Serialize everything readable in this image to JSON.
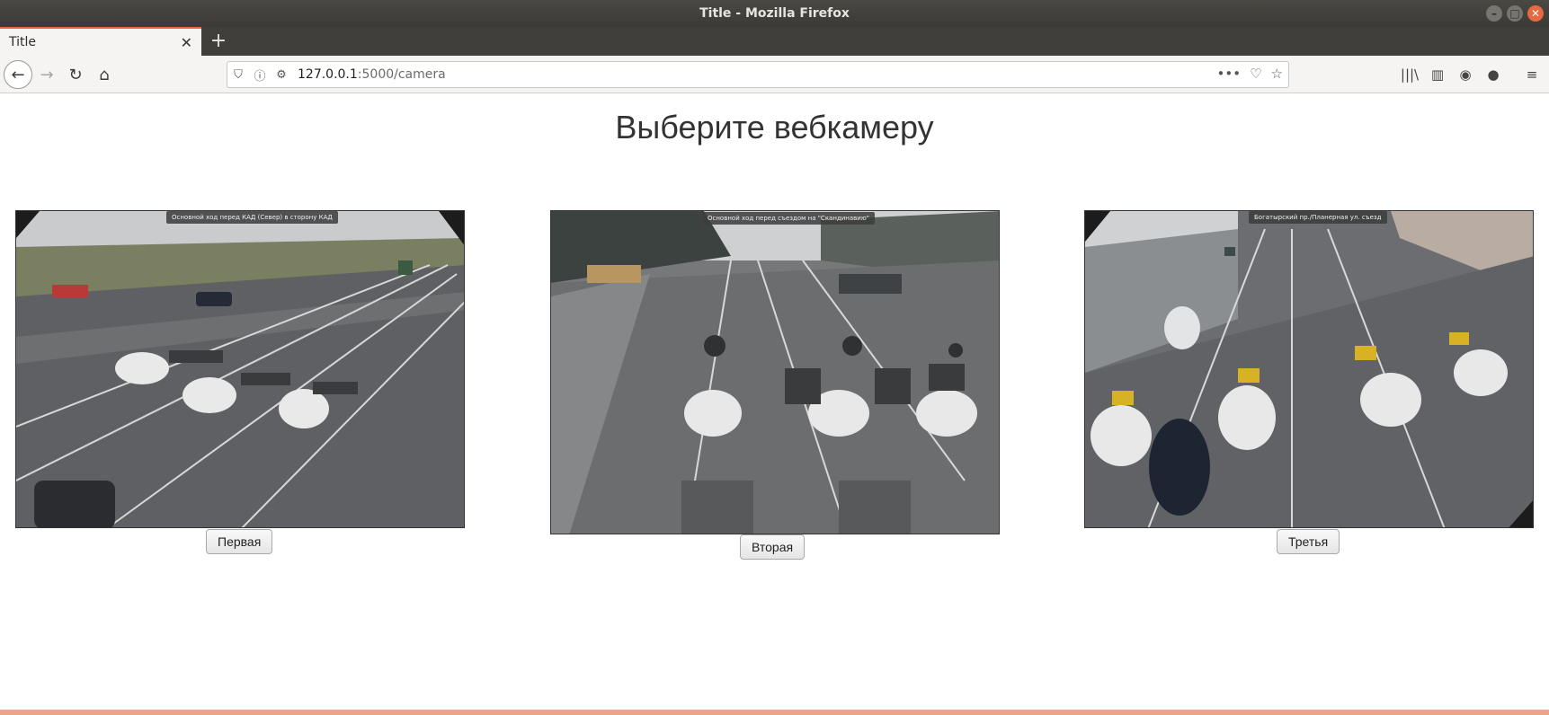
{
  "window": {
    "title": "Title - Mozilla Firefox",
    "controls": {
      "minimize": "–",
      "maximize": "□",
      "close": "✕"
    }
  },
  "tabs": [
    {
      "label": "Title",
      "close": "✕"
    }
  ],
  "new_tab_label": "+",
  "nav": {
    "back": "←",
    "forward": "→",
    "reload": "↻",
    "home": "⌂"
  },
  "urlbar": {
    "host": "127.0.0.1",
    "path": ":5000/camera",
    "shield": "⛉",
    "info": "ⓘ",
    "perm": "⚙"
  },
  "url_actions": {
    "more": "•••",
    "pocket": "♡",
    "bookmark": "☆"
  },
  "toolbar_right": {
    "library": "|||\\",
    "sidebar": "▥",
    "account": "◉",
    "extension": "●",
    "menu": "≡"
  },
  "page": {
    "heading": "Выберите вебкамеру",
    "cameras": [
      {
        "caption": "Основной ход перед КАД (Север) в сторону КАД",
        "button": "Первая"
      },
      {
        "caption": "Основной ход перед съездом на \"Скандинавию\"",
        "button": "Вторая"
      },
      {
        "caption": "Богатырский пр./Планерная ул. съезд",
        "button": "Третья"
      }
    ]
  },
  "colors": {
    "accent": "#e9683f",
    "titlebar": "#3b3a36",
    "toolbar": "#f5f4f2"
  }
}
